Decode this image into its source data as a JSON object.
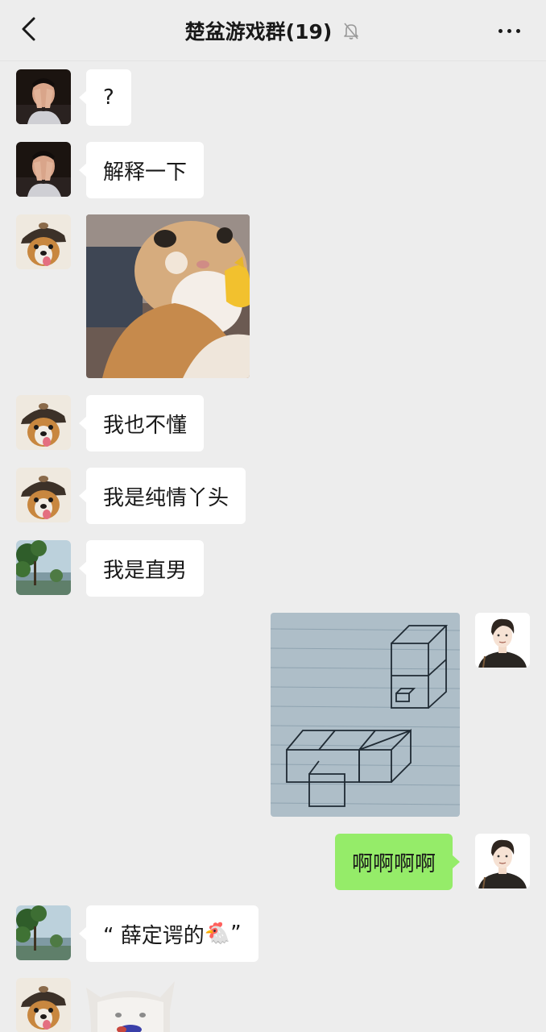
{
  "header": {
    "title": "楚盆游戏群(19)",
    "back_icon": "chevron-left-icon",
    "mute_icon": "bell-off-icon",
    "more_icon": "more-dots-icon"
  },
  "colors": {
    "background": "#ededed",
    "bubble_in": "#ffffff",
    "bubble_out": "#95ec69"
  },
  "messages": [
    {
      "sender_avatar": "face-palm-man-avatar",
      "type": "text",
      "text": "?"
    },
    {
      "sender_avatar": "face-palm-man-avatar",
      "type": "text",
      "text": "解释一下"
    },
    {
      "sender_avatar": "dog-hat-avatar",
      "type": "image",
      "content": "cat-meme-image"
    },
    {
      "sender_avatar": "dog-hat-avatar",
      "type": "text",
      "text": "我也不懂"
    },
    {
      "sender_avatar": "dog-hat-avatar",
      "type": "text",
      "text": "我是纯情丫头"
    },
    {
      "sender_avatar": "tree-landscape-avatar",
      "type": "text",
      "text": "我是直男"
    },
    {
      "sender_avatar": "self-cartoon-avatar",
      "type": "image",
      "content": "cube-sketch-image",
      "outgoing": true
    },
    {
      "sender_avatar": "self-cartoon-avatar",
      "type": "text",
      "text": "啊啊啊啊",
      "outgoing": true
    },
    {
      "sender_avatar": "tree-landscape-avatar",
      "type": "text",
      "text": "“ 薛定谔的",
      "emoji": "🐔",
      "text_end": " ”"
    },
    {
      "sender_avatar": "dog-hat-avatar",
      "type": "image",
      "content": "cat-meme-image-2"
    }
  ]
}
